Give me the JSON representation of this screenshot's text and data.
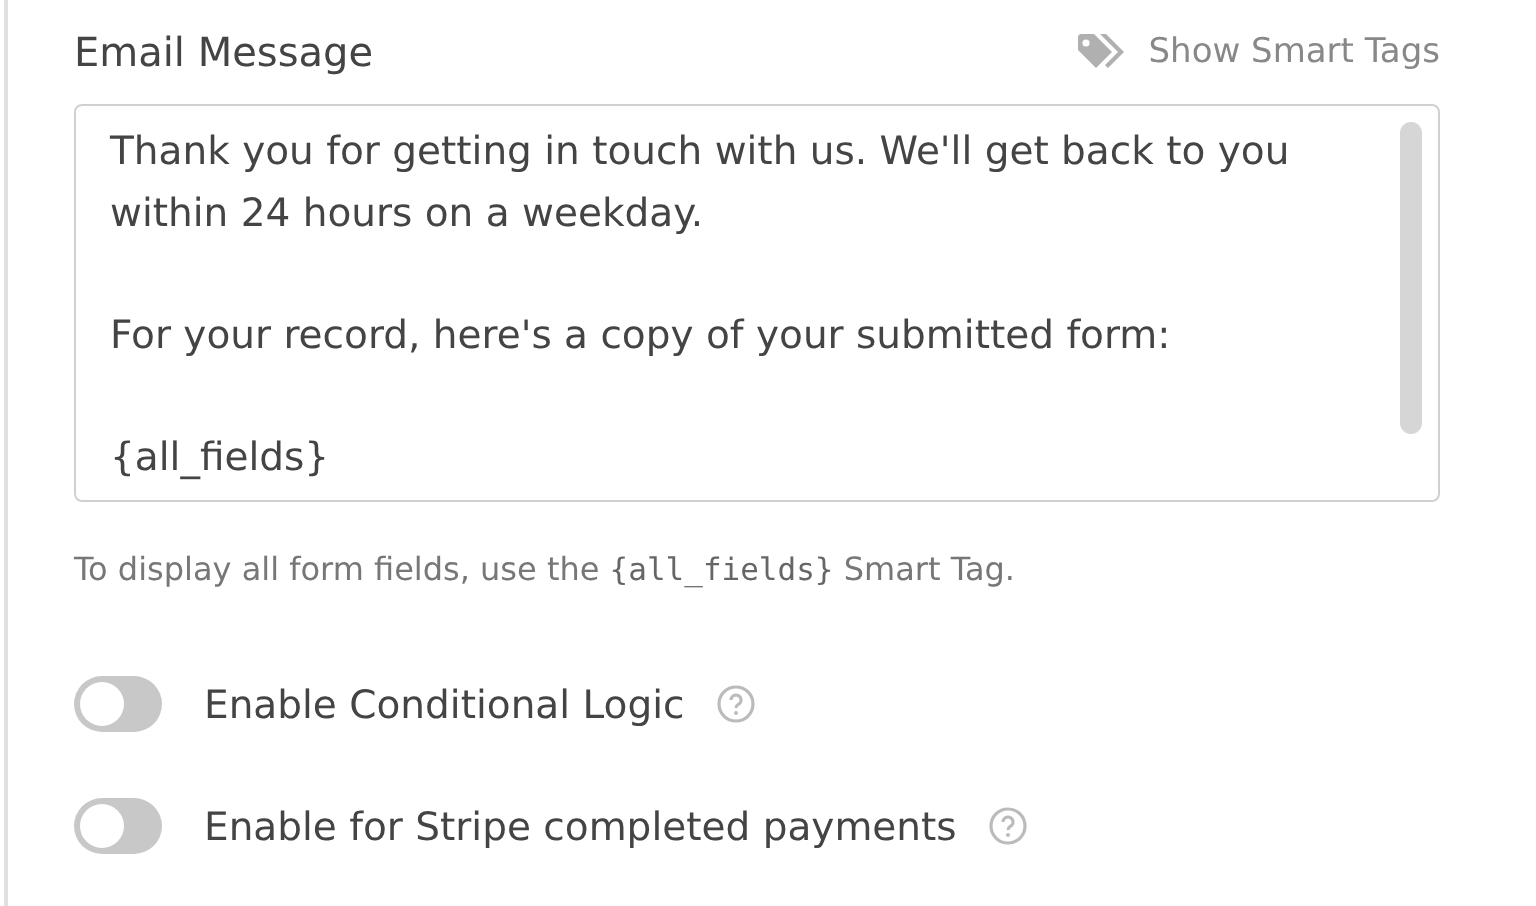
{
  "field_label": "Email Message",
  "smart_tags_link": "Show Smart Tags",
  "message": {
    "value": "Thank you for getting in touch with us. We'll get back to you within 24 hours on a weekday.\n\nFor your record, here's a copy of your submitted form:\n\n{all_fields}"
  },
  "hint": {
    "before": "To display all form fields, use the ",
    "code": "{all_fields}",
    "after": " Smart Tag."
  },
  "toggles": [
    {
      "label": "Enable Conditional Logic",
      "on": false
    },
    {
      "label": "Enable for Stripe completed payments",
      "on": false
    }
  ]
}
